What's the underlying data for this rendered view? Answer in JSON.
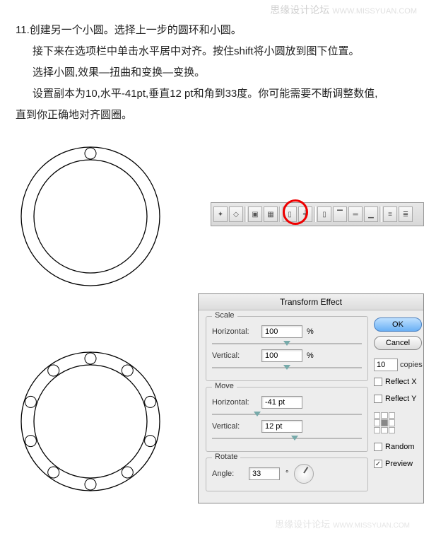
{
  "watermark": {
    "cn": "思缘设计论坛",
    "en": "WWW.MISSYUAN.COM"
  },
  "instructions": {
    "p1": "11.创建另一个小圆。选择上一步的圆环和小圆。",
    "p2": "接下来在选项栏中单击水平居中对齐。按住shift将小圆放到图下位置。",
    "p3": "选择小圆,效果—扭曲和变换—变换。",
    "p4": "设置副本为10,水平-41pt,垂直12 pt和角到33度。你可能需要不断调整数值,",
    "p5": "直到你正确地对齐圆圈。"
  },
  "dialog": {
    "title": "Transform Effect",
    "scale_legend": "Scale",
    "horizontal_label": "Horizontal:",
    "vertical_label": "Vertical:",
    "scale_h_value": "100",
    "scale_v_value": "100",
    "percent": "%",
    "move_legend": "Move",
    "move_h_value": "-41 pt",
    "move_v_value": "12 pt",
    "rotate_legend": "Rotate",
    "angle_label": "Angle:",
    "angle_value": "33",
    "degree": "°",
    "ok": "OK",
    "cancel": "Cancel",
    "copies_value": "10",
    "copies_label": "copies",
    "reflect_x": "Reflect X",
    "reflect_y": "Reflect Y",
    "random": "Random",
    "preview": "Preview"
  }
}
